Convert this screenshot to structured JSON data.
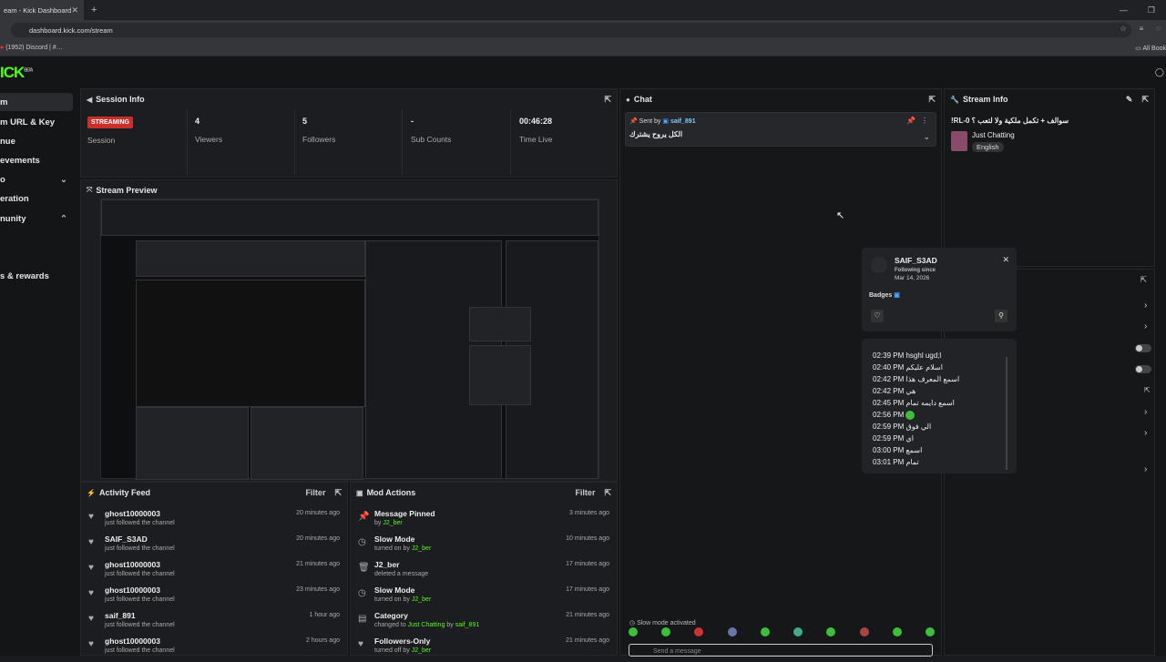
{
  "browser": {
    "tab_title": "eam - Kick Dashboard",
    "url": "dashboard.kick.com/stream",
    "bookmark": "(1952) Discord | #…",
    "all_bookmarks": "All Book"
  },
  "logo": "ICK",
  "sidebar": {
    "items": [
      {
        "label": "m"
      },
      {
        "label": "m URL & Key"
      },
      {
        "label": "nue"
      },
      {
        "label": "evements"
      },
      {
        "label": "o"
      },
      {
        "label": "eration"
      },
      {
        "label": "nunity"
      },
      {
        "label": "s & rewards"
      }
    ]
  },
  "session": {
    "title": "Session Info",
    "status": "STREAMING",
    "session_label": "Session",
    "viewers_value": "4",
    "viewers_label": "Viewers",
    "followers_value": "5",
    "followers_label": "Followers",
    "subs_value": "-",
    "subs_label": "Sub Counts",
    "time_value": "00:46:28",
    "time_label": "Time Live"
  },
  "preview": {
    "title": "Stream Preview"
  },
  "chat": {
    "title": "Chat",
    "pinned_prefix": "Sent by",
    "pinned_user": "saif_891",
    "pinned_text": "الكل يروح يشترك",
    "slow_mode": "Slow mode activated",
    "send_placeholder": "Send a message"
  },
  "stream_info": {
    "title": "Stream Info",
    "stream_title": "!RL-0 سوالف + تكمل ملكية ولا لتعب ؟",
    "category": "Just Chatting",
    "language": "English"
  },
  "user_popup": {
    "username": "SAIF_S3AD",
    "following_since_label": "Following since",
    "following_since": "Mar 14, 2026",
    "badges_label": "Badges"
  },
  "user_messages": [
    {
      "time": "02:39 PM",
      "text": "hsghl ugd;l"
    },
    {
      "time": "02:40 PM",
      "text": "اسلام عليكم"
    },
    {
      "time": "02:42 PM",
      "text": "اسمع المعرف هذا"
    },
    {
      "time": "02:42 PM",
      "text": "هي"
    },
    {
      "time": "02:45 PM",
      "text": "اسمع دايمه تمام"
    },
    {
      "time": "02:56 PM",
      "text": ""
    },
    {
      "time": "02:59 PM",
      "text": "الي فوق"
    },
    {
      "time": "02:59 PM",
      "text": "اي"
    },
    {
      "time": "03:00 PM",
      "text": "اسمع"
    },
    {
      "time": "03:01 PM",
      "text": "تمام"
    }
  ],
  "activity": {
    "title": "Activity Feed",
    "filter": "Filter",
    "rows": [
      {
        "name": "ghost10000003",
        "sub": "just followed the channel",
        "time": "20 minutes ago"
      },
      {
        "name": "SAIF_S3AD",
        "sub": "just followed the channel",
        "time": "20 minutes ago"
      },
      {
        "name": "ghost10000003",
        "sub": "just followed the channel",
        "time": "21 minutes ago"
      },
      {
        "name": "ghost10000003",
        "sub": "just followed the channel",
        "time": "23 minutes ago"
      },
      {
        "name": "saif_891",
        "sub": "just followed the channel",
        "time": "1 hour ago"
      },
      {
        "name": "ghost10000003",
        "sub": "just followed the channel",
        "time": "2 hours ago"
      }
    ]
  },
  "mod": {
    "title": "Mod Actions",
    "filter": "Filter",
    "rows": [
      {
        "name": "Message Pinned",
        "pre": "by",
        "user": "J2_ber",
        "post": "",
        "time": "3 minutes ago"
      },
      {
        "name": "Slow Mode",
        "pre": "turned on by",
        "user": "J2_ber",
        "post": "",
        "time": "10 minutes ago"
      },
      {
        "name": "J2_ber",
        "pre": "deleted a message",
        "user": "",
        "post": "",
        "time": "17 minutes ago"
      },
      {
        "name": "Slow Mode",
        "pre": "turned on by",
        "user": "J2_ber",
        "post": "",
        "time": "17 minutes ago"
      },
      {
        "name": "Category",
        "pre": "changed to",
        "user": "Just Chatting",
        "post": "saif_891",
        "time": "21 minutes ago"
      },
      {
        "name": "Followers-Only",
        "pre": "turned off by",
        "user": "J2_ber",
        "post": "",
        "time": "21 minutes ago"
      }
    ]
  }
}
